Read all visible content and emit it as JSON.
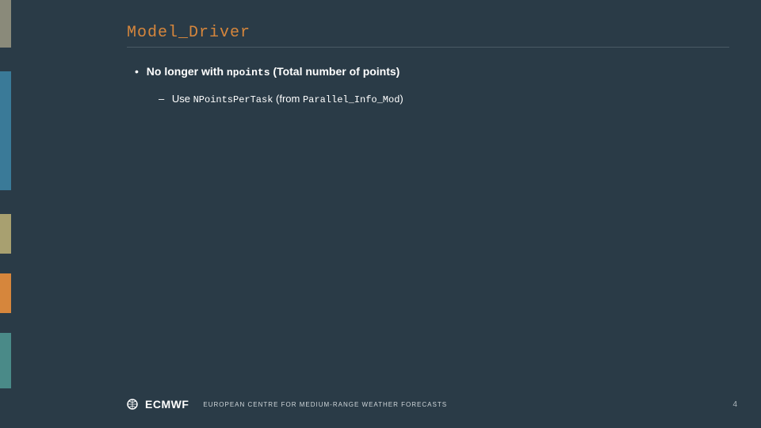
{
  "title": "Model_Driver",
  "bullet1": {
    "prefix": "No longer with ",
    "code": "npoints",
    "suffix": " (Total number of points)"
  },
  "bullet2": {
    "prefix": "Use ",
    "code1": "NPointsPerTask",
    "mid": " (from ",
    "code2": "Parallel_Info_Mod",
    "suffix": ")"
  },
  "footer": {
    "logo_text": "ECMWF",
    "tagline": "EUROPEAN CENTRE FOR MEDIUM-RANGE WEATHER FORECASTS",
    "page": "4"
  },
  "colors": {
    "bg": "#2a3b47",
    "accent": "#d6863c"
  }
}
